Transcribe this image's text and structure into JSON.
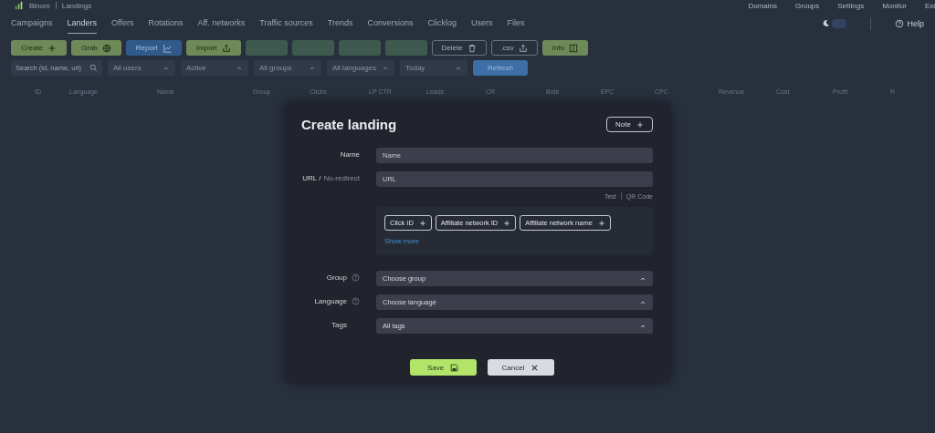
{
  "header": {
    "brand": "Binom",
    "page": "Landings",
    "links": [
      "Domains",
      "Groups",
      "Settings",
      "Monitor",
      "Exi"
    ],
    "help": "Help"
  },
  "tabs": [
    {
      "label": "Campaigns",
      "selected": false
    },
    {
      "label": "Landers",
      "selected": true
    },
    {
      "label": "Offers",
      "selected": false
    },
    {
      "label": "Rotations",
      "selected": false
    },
    {
      "label": "Aff. networks",
      "selected": false
    },
    {
      "label": "Traffic sources",
      "selected": false
    },
    {
      "label": "Trends",
      "selected": false
    },
    {
      "label": "Conversions",
      "selected": false
    },
    {
      "label": "Clicklog",
      "selected": false
    },
    {
      "label": "Users",
      "selected": false
    },
    {
      "label": "Files",
      "selected": false
    }
  ],
  "toolbar": [
    {
      "kind": "green",
      "label": "Create"
    },
    {
      "kind": "green",
      "label": "Grab"
    },
    {
      "kind": "blue",
      "label": "Report"
    },
    {
      "kind": "green",
      "label": "Import"
    },
    {
      "kind": "disabled"
    },
    {
      "kind": "disabled"
    },
    {
      "kind": "disabled"
    },
    {
      "kind": "disabled"
    },
    {
      "kind": "outline",
      "label": "Delete"
    },
    {
      "kind": "outline",
      "label": ".csv"
    },
    {
      "kind": "green",
      "label": "Info"
    }
  ],
  "filters": {
    "search_placeholder": "Search (id, name, url)",
    "selects": [
      "All users",
      "Active",
      "All groups",
      "All languages",
      "Today"
    ],
    "refresh": "Refresh"
  },
  "table": {
    "columns": [
      "ID",
      "Language",
      "Name",
      "Group",
      "Clicks",
      "LP CTR",
      "Leads",
      "CR",
      "Bots",
      "EPC",
      "CPC",
      "Revenue",
      "Cost",
      "Profit",
      "R"
    ]
  },
  "dialog": {
    "title": "Create landing",
    "note": "Note",
    "name": {
      "label": "Name",
      "placeholder": "Name"
    },
    "url": {
      "label": "URL /",
      "sublabel": "No-redirect",
      "placeholder": "URL"
    },
    "url_links": [
      "Test",
      "QR Code"
    ],
    "tokens": [
      "Click ID",
      "Affiliate network ID",
      "Affiliate network name"
    ],
    "show_more": "Show more",
    "selects": [
      {
        "label": "Group",
        "help": true,
        "value": "Choose group"
      },
      {
        "label": "Language",
        "help": true,
        "value": "Choose language"
      },
      {
        "label": "Tags",
        "help": false,
        "value": "All tags"
      }
    ],
    "save": "Save",
    "cancel": "Cancel"
  }
}
